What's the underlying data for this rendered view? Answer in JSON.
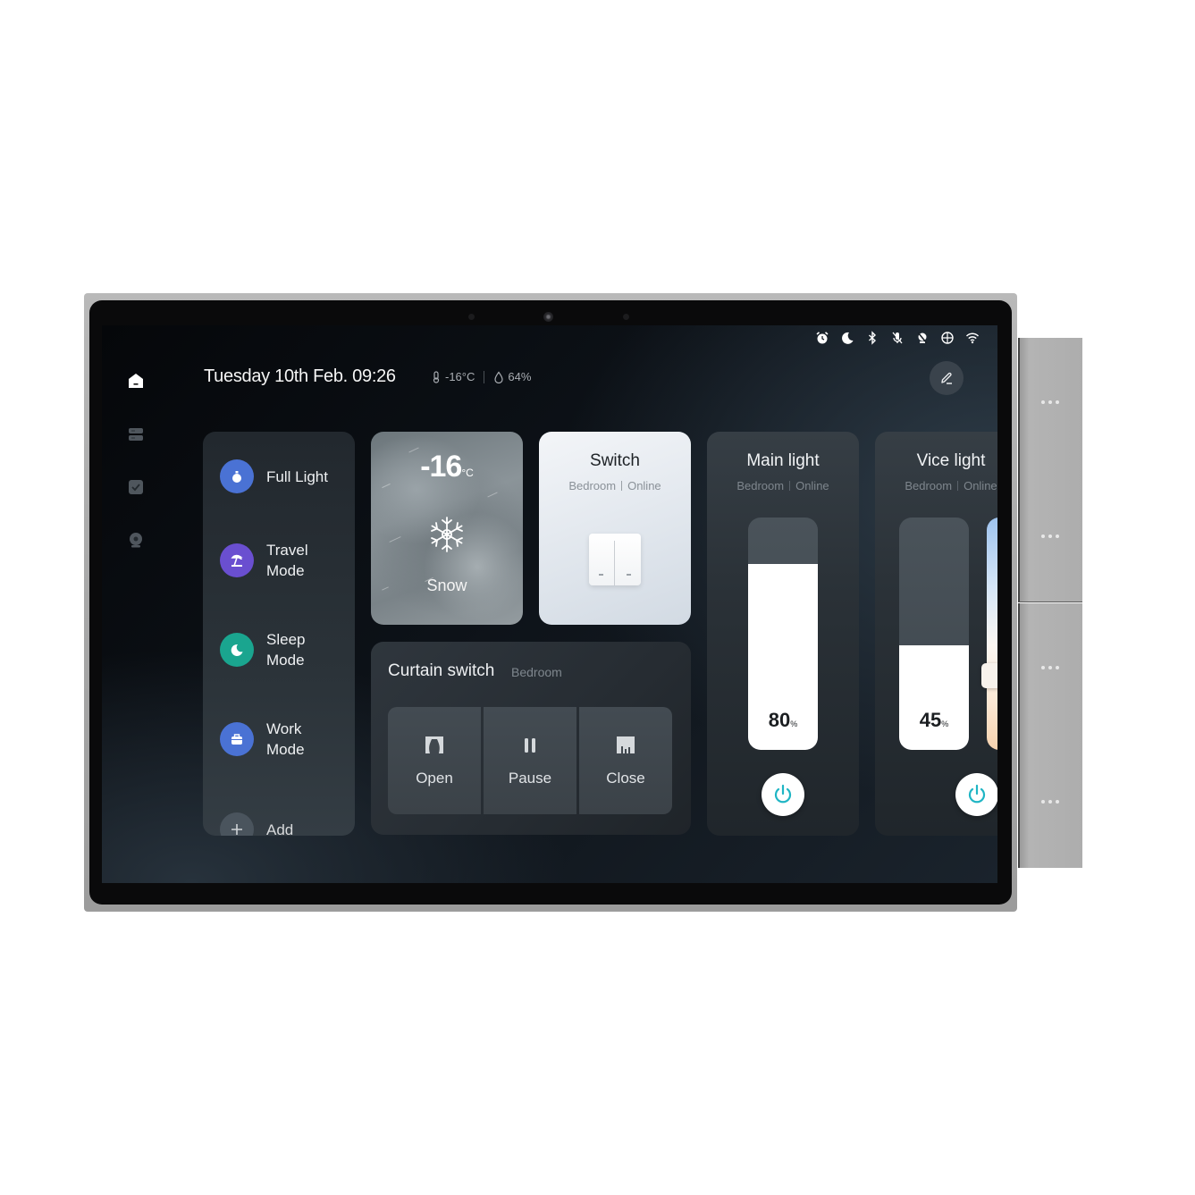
{
  "status_bar": {
    "icons": [
      "alarm-icon",
      "moon-icon",
      "bluetooth-icon",
      "mic-off-icon",
      "do-not-disturb-icon",
      "globe-icon",
      "wifi-icon"
    ]
  },
  "nav": {
    "items": [
      {
        "name": "home",
        "icon": "home-icon",
        "active": true
      },
      {
        "name": "devices",
        "icon": "devices-icon",
        "active": false
      },
      {
        "name": "tasks",
        "icon": "checkbox-icon",
        "active": false
      },
      {
        "name": "camera",
        "icon": "camera-icon",
        "active": false
      }
    ]
  },
  "header": {
    "datetime": "Tuesday 10th Feb. 09:26",
    "temperature": "-16°C",
    "humidity": "64%"
  },
  "scenes": {
    "items": [
      {
        "label": "Full Light",
        "icon": "light-bulb-icon",
        "color": "#4a72d4"
      },
      {
        "label": "Travel Mode",
        "icon": "palm-tree-icon",
        "color": "#6a4fd0"
      },
      {
        "label": "Sleep Mode",
        "icon": "moon-icon",
        "color": "#1aa58f"
      },
      {
        "label": "Work Mode",
        "icon": "briefcase-icon",
        "color": "#4a72d4"
      },
      {
        "label": "Add",
        "icon": "plus-icon",
        "color": "#4a545d"
      }
    ]
  },
  "weather": {
    "temp_value": "-16",
    "temp_unit": "°C",
    "condition": "Snow",
    "icon": "snowflake-icon"
  },
  "switch_card": {
    "title": "Switch",
    "room": "Bedroom",
    "status": "Online"
  },
  "curtain": {
    "title": "Curtain switch",
    "room": "Bedroom",
    "buttons": [
      {
        "label": "Open",
        "icon": "curtain-open-icon"
      },
      {
        "label": "Pause",
        "icon": "pause-icon"
      },
      {
        "label": "Close",
        "icon": "curtain-close-icon"
      }
    ]
  },
  "lights": [
    {
      "title": "Main light",
      "room": "Bedroom",
      "status": "Online",
      "brightness": 80,
      "brightness_label": "80",
      "unit": "%"
    },
    {
      "title": "Vice light",
      "room": "Bedroom",
      "status": "Online",
      "brightness": 45,
      "brightness_label": "45",
      "unit": "%",
      "color_temp_position": 0.68
    }
  ],
  "colors": {
    "power_accent": "#1fb5c4"
  }
}
